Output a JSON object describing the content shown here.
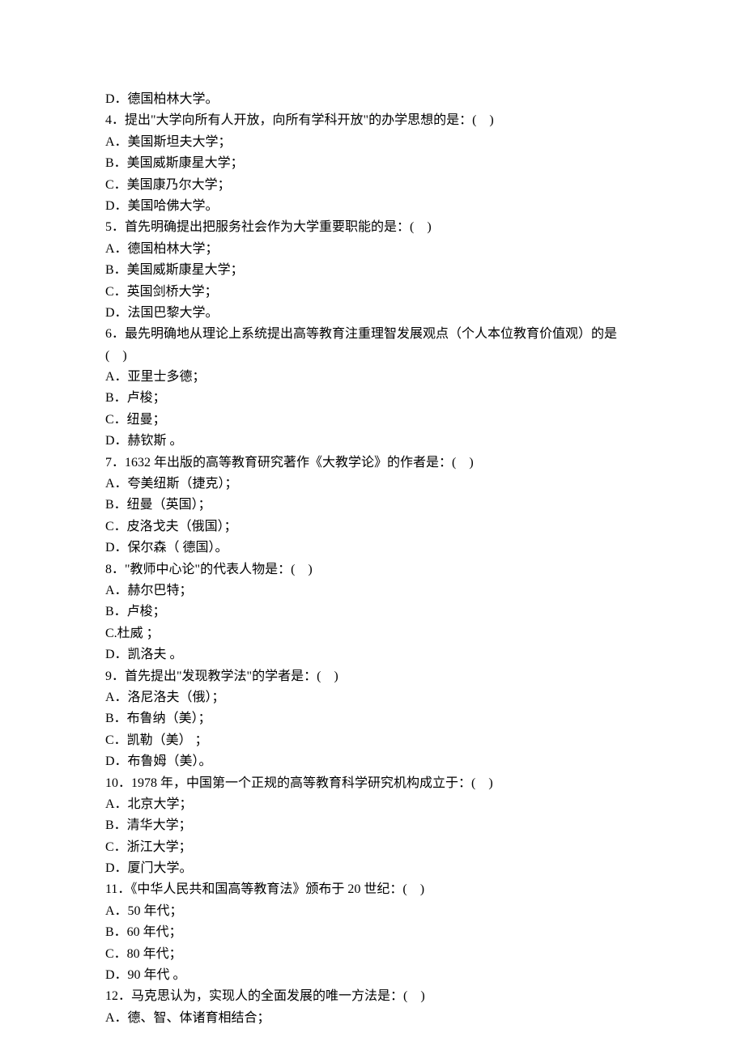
{
  "lines": [
    "D．德国柏林大学。",
    "4．提出\"大学向所有人开放，向所有学科开放\"的办学思想的是：(    )",
    "A．美国斯坦夫大学；",
    "B．美国威斯康星大学；",
    "C．美国康乃尔大学；",
    "D．美国哈佛大学。",
    "5．首先明确提出把服务社会作为大学重要职能的是：(    )",
    "A．德国柏林大学；",
    "B．美国威斯康星大学；",
    "C．英国剑桥大学；",
    "D．法国巴黎大学。",
    "6．最先明确地从理论上系统提出高等教育注重理智发展观点（个人本位教育价值观）的是",
    "(    )",
    "A．亚里士多德；",
    "B．卢梭；",
    "C．纽曼；",
    "D．赫钦斯 。",
    "7．1632 年出版的高等教育研究著作《大教学论》的作者是：(    )",
    "A．夸美纽斯（捷克）；",
    "B．纽曼（英国）；",
    "C．皮洛戈夫（俄国）；",
    "D．保尔森（ 德国）。",
    "8．\"教师中心论\"的代表人物是：(    )",
    "A．赫尔巴特；",
    "B．卢梭；",
    "C.杜威 ；",
    "D．凯洛夫 。",
    "9．首先提出\"发现教学法\"的学者是：(    )",
    "A．洛尼洛夫（俄）；",
    "B．布鲁纳（美）；",
    "C．凯勒（美） ；",
    "D．布鲁姆（美）。",
    "10．1978 年，中国第一个正规的高等教育科学研究机构成立于：(    )",
    "A．北京大学；",
    "B．清华大学；",
    "C．浙江大学；",
    "D．厦门大学。",
    "11．《中华人民共和国高等教育法》颁布于 20 世纪：(    )",
    "A．50 年代；",
    "B．60 年代；",
    "C．80 年代；",
    "D．90 年代 。",
    "12．马克思认为，实现人的全面发展的唯一方法是：(    )",
    "A．德、智、体诸育相结合；"
  ]
}
